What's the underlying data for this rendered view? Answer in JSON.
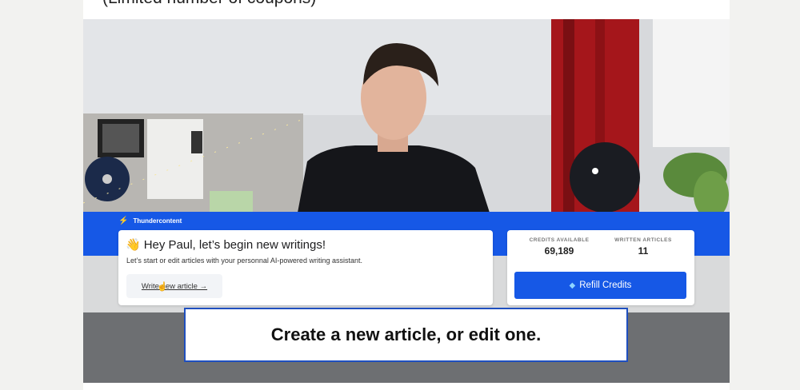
{
  "page": {
    "heading_partial": "(Limited number of coupons)"
  },
  "video": {
    "app": {
      "brand": "Thundercontent",
      "greeting_emoji": "👋",
      "greeting": "Hey Paul, let’s begin new writings!",
      "subtext": "Let’s start or edit articles with your personnal AI-powered writing assistant.",
      "write_button": "Write new article →",
      "stats": [
        {
          "label": "CREDITS AVAILABLE",
          "value": "69,189"
        },
        {
          "label": "WRITTEN ARTICLES",
          "value": "11"
        }
      ],
      "refill_button": "Refill Credits"
    },
    "caption": "Create a new article, or edit one."
  },
  "colors": {
    "brand_blue": "#1658e6",
    "caption_border": "#1f4fbf"
  }
}
